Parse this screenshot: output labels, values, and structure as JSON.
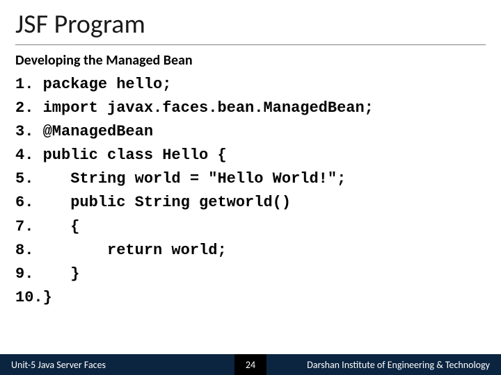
{
  "slide": {
    "title": "JSF Program",
    "subhead": "Developing the Managed Bean",
    "code_lines": [
      "1. package hello;",
      "2. import javax.faces.bean.ManagedBean;",
      "3. @ManagedBean",
      "4. public class Hello {",
      "5.    String world = \"Hello World!\";",
      "6.    public String getworld()",
      "7.    {",
      "8.        return world;",
      "9.    }",
      "10.}"
    ]
  },
  "footer": {
    "left": "Unit-5 Java Server Faces",
    "page": "24",
    "right": "Darshan Institute of Engineering & Technology"
  }
}
